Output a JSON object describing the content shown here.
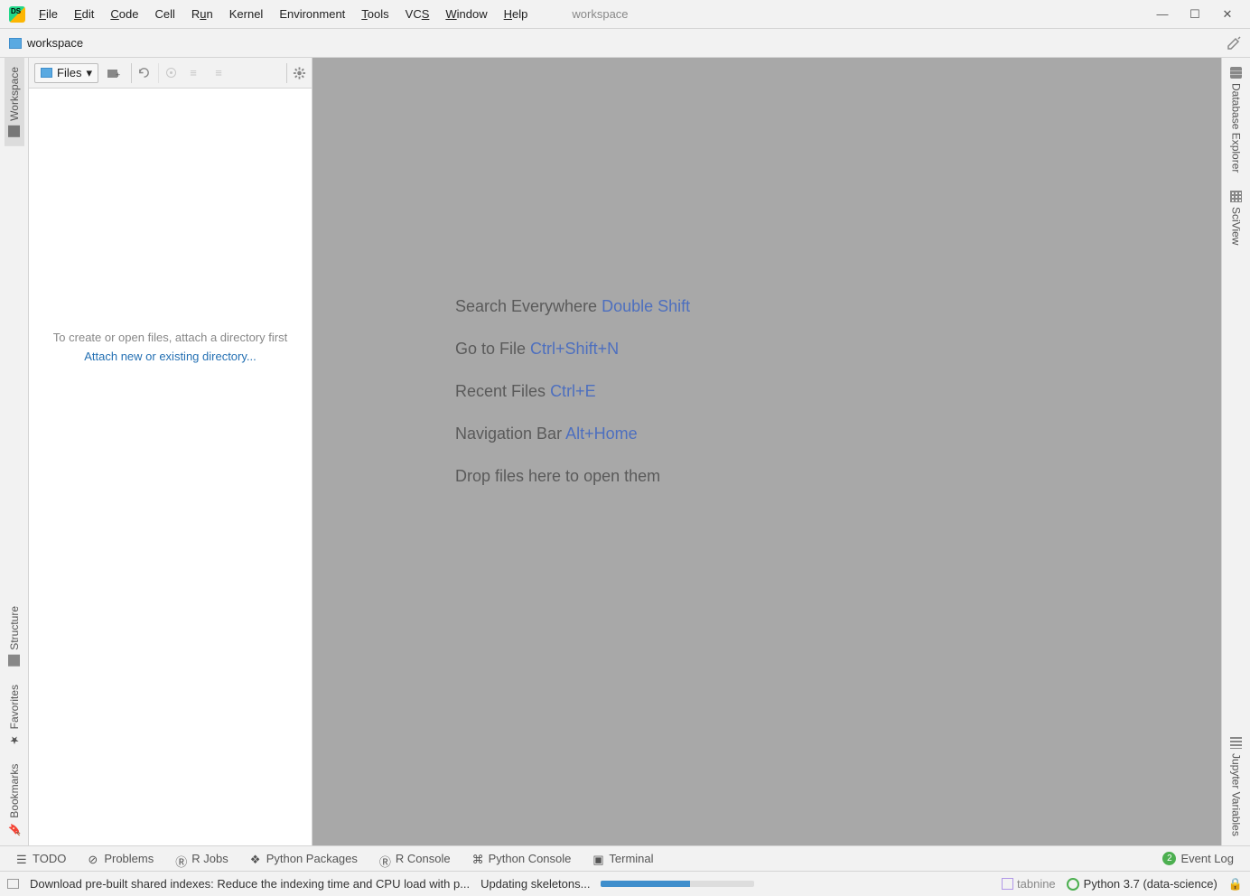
{
  "menu": {
    "items": [
      "File",
      "Edit",
      "Code",
      "Cell",
      "Run",
      "Kernel",
      "Environment",
      "Tools",
      "VCS",
      "Window",
      "Help"
    ],
    "underlines": [
      "F",
      "E",
      "C",
      "",
      "u",
      "",
      "",
      "T",
      "S",
      "W",
      "H"
    ]
  },
  "title": "workspace",
  "breadcrumb": "workspace",
  "left_tabs": {
    "top": [
      "Workspace"
    ],
    "bottom": [
      "Structure",
      "Favorites",
      "Bookmarks"
    ]
  },
  "right_tabs": {
    "top": [
      "Database Explorer",
      "SciView"
    ],
    "bottom": [
      "Jupyter Variables"
    ]
  },
  "files": {
    "combo": "Files",
    "hint": "To create or open files, attach a directory first",
    "link": "Attach new or existing directory..."
  },
  "editor_hints": [
    {
      "label": "Search Everywhere",
      "shortcut": "Double Shift"
    },
    {
      "label": "Go to File",
      "shortcut": "Ctrl+Shift+N"
    },
    {
      "label": "Recent Files",
      "shortcut": "Ctrl+E"
    },
    {
      "label": "Navigation Bar",
      "shortcut": "Alt+Home"
    },
    {
      "label": "Drop files here to open them",
      "shortcut": ""
    }
  ],
  "bottom_tabs": [
    "TODO",
    "Problems",
    "R Jobs",
    "Python Packages",
    "R Console",
    "Python Console",
    "Terminal"
  ],
  "event_log": {
    "count": "2",
    "label": "Event Log"
  },
  "status": {
    "msg1": "Download pre-built shared indexes: Reduce the indexing time and CPU load with p...",
    "msg2": "Updating skeletons...",
    "progress_pct": 58,
    "tabnine": "tabnine",
    "python": "Python 3.7 (data-science)"
  }
}
